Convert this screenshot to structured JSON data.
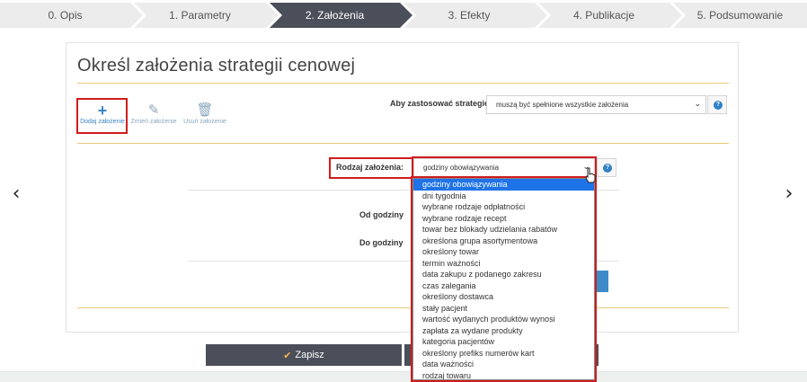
{
  "wizard": {
    "steps": [
      {
        "label": "0. Opis"
      },
      {
        "label": "1. Parametry"
      },
      {
        "label": "2. Założenia"
      },
      {
        "label": "3. Efekty"
      },
      {
        "label": "4. Publikacje"
      },
      {
        "label": "5. Podsumowanie"
      }
    ],
    "active_index": 2
  },
  "panel": {
    "title": "Określ założenia strategii cenowej"
  },
  "toolbar": {
    "add_label": "Dodaj założenie",
    "edit_label": "Zmień założenie",
    "delete_label": "Usuń założenie",
    "add_icon": "plus-icon",
    "edit_icon": "edit-icon",
    "delete_icon": "trash-icon"
  },
  "apply_strategy": {
    "label": "Aby zastosować strategię",
    "selected": "muszą być spełnione wszystkie założenia"
  },
  "assumption_type": {
    "label": "Rodzaj założenia:",
    "selected": "godziny obowiązywania",
    "options": [
      "godziny obowiązywania",
      "dni tygodnia",
      "wybrane rodzaje odpłatności",
      "wybrane rodzaje recept",
      "towar bez blokady udzielania rabatów",
      "określona grupa asortymentowa",
      "określony towar",
      "termin ważności",
      "data zakupu z podanego zakresu",
      "czas zalegania",
      "określony dostawca",
      "stały pacjent",
      "wartość wydanych produktów wynosi",
      "zapłata za wydane produkty",
      "kategoria pacjentów",
      "określony prefiks numerów kart",
      "data ważności",
      "rodzaj towaru"
    ]
  },
  "hours": {
    "from_label": "Od godziny",
    "to_label": "Do godziny"
  },
  "footer": {
    "save_label": "Zapisz"
  },
  "colors": {
    "active_step": "#4b4f5a",
    "highlight": "#d01c1c",
    "selected_option": "#1e73e8",
    "gold_divider": "#e8c87a"
  }
}
